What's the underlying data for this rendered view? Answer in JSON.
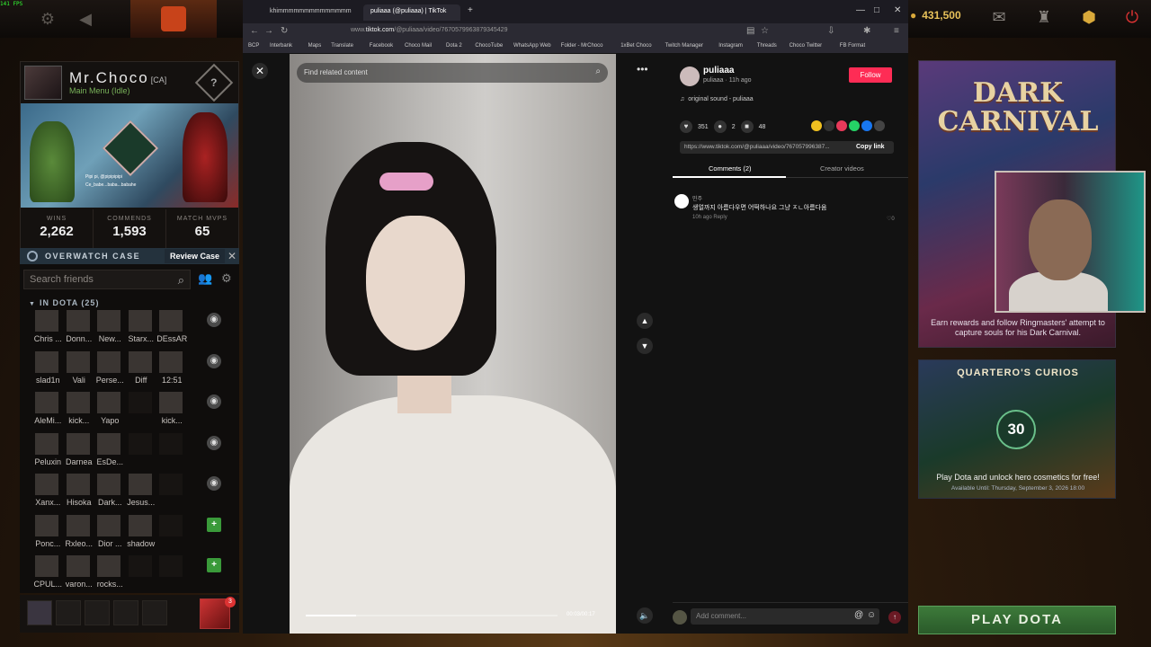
{
  "fps": "141 FPS",
  "dota": {
    "gold": "431,500",
    "profile": {
      "name": "Mr.Choco",
      "tag": "[CA]",
      "status": "Main Menu (Idle)",
      "help": "?",
      "voice_line1": "Pipi pi, @pipipipipi",
      "voice_line2": "Ce_babe...baba...babahe",
      "stats": [
        {
          "label": "WINS",
          "value": "2,262"
        },
        {
          "label": "COMMENDS",
          "value": "1,593"
        },
        {
          "label": "MATCH MVPS",
          "value": "65"
        }
      ]
    },
    "overwatch": {
      "title": "OVERWATCH CASE",
      "review": "Review Case",
      "close": "✕"
    },
    "friends": {
      "search_placeholder": "Search friends",
      "group": "IN DOTA (25)",
      "rows": [
        {
          "names": [
            "Chris ...",
            "Donn...",
            "New...",
            "Starx...",
            "DEssAR"
          ],
          "action": "◉"
        },
        {
          "names": [
            "slad1n",
            "Vali",
            "Perse...",
            "Diff",
            "12:51"
          ],
          "action": "◉"
        },
        {
          "names": [
            "AleMi...",
            "kick...",
            "Yapo",
            "",
            "kick..."
          ],
          "action": "◉"
        },
        {
          "names": [
            "Peluxin",
            "Darnea",
            "EsDe...",
            "",
            ""
          ],
          "action": "◉"
        },
        {
          "names": [
            "Xanx...",
            "Hisoka",
            "Dark...",
            "Jesus...",
            ""
          ],
          "action": "◉"
        },
        {
          "names": [
            "Ponc...",
            "Rxleo...",
            "Dior ...",
            "shadow",
            ""
          ],
          "action": "+"
        },
        {
          "names": [
            "CPUL...",
            "varon...",
            "rocks...",
            "",
            ""
          ],
          "action": "+"
        }
      ]
    },
    "party_badge": "3",
    "carnival": {
      "logo": "DARK CARNIVAL",
      "desc": "Earn rewards and follow Ringmasters' attempt to capture souls for his Dark Carnival."
    },
    "curios": {
      "title": "QUARTERO'S CURIOS",
      "num": "30",
      "sub": "Play Dota and unlock hero cosmetics for free!",
      "avail": "Available Until:  Thursday, September 3, 2026 18:00"
    },
    "play": "PLAY DOTA"
  },
  "browser": {
    "tabs": [
      "khimmmmmmmmmmmmmm",
      "puliaaa (@puliaaa) | TikTok"
    ],
    "url_host": "www.",
    "url_domain": "tiktok.com",
    "url_path": "/@puliaaa/video/7670579963879345429",
    "bookmarks": [
      "BCP",
      "Interbank",
      "Maps",
      "Translate",
      "Facebook",
      "Choco Mail",
      "Dota 2",
      "ChocoTube",
      "WhatsApp Web",
      "Folder - MrChoco",
      "1xBet Choco",
      "Twitch Manager",
      "Instagram",
      "Threads",
      "Choco Twitter",
      "FB Format"
    ]
  },
  "tiktok": {
    "search_placeholder": "Find related content",
    "time": "00:03/00:17",
    "progress": 0.2,
    "user": "puliaaa",
    "meta": "puliaaa · 11h ago",
    "follow": "Follow",
    "sound": "original sound - puliaaa",
    "likes": "351",
    "comments": "2",
    "saves": "48",
    "link": "https://www.tiktok.com/@puliaaa/video/767057996387...",
    "copy": "Copy link",
    "tab_comments": "Comments (2)",
    "tab_creator": "Creator videos",
    "comment": {
      "user": "민주",
      "text": "생얼까지 아름다우면 어떡하나요 그냥 ㅈㄴ아름다움",
      "time": "10h ago",
      "reply": "Reply",
      "likes": "0"
    },
    "add_comment": "Add comment..."
  }
}
